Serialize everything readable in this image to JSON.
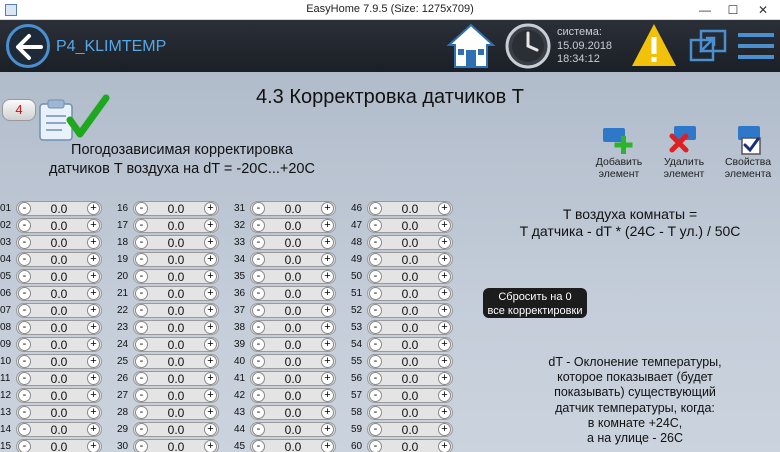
{
  "window": {
    "title": "EasyHome 7.9.5 (Size: 1275x709)",
    "min": "—",
    "max": "☐",
    "close": "✕"
  },
  "header": {
    "page_code": "P4_KLIMTEMP",
    "system_label": "система:",
    "date": "15.09.2018",
    "time": "18:34:12"
  },
  "page": {
    "title": "4.3 Корректровка датчиков T",
    "badge": "4",
    "subtitle_line1": "Погодозависимая корректировка",
    "subtitle_line2": "датчиков T воздуха на dT = -20C...+20C"
  },
  "toolbar": {
    "add_l1": "Добавить",
    "add_l2": "элемент",
    "del_l1": "Удалить",
    "del_l2": "элемент",
    "props_l1": "Свойства",
    "props_l2": "элемента"
  },
  "formula": {
    "line1": "T воздуха комнаты =",
    "line2": "T датчика - dT * (24C - T ул.) / 50C"
  },
  "reset": {
    "line1": "Сбросить на 0",
    "line2": "все корректировки"
  },
  "note": {
    "l1": "dT - Оклонение температуры,",
    "l2": "которое показывает (будет",
    "l3": "показывать) существующий",
    "l4": "датчик температуры, когда:",
    "l5": "в комнате +24С,",
    "l6": "а на улице - 26С"
  },
  "stepper": {
    "minus": "-",
    "plus": "+"
  },
  "sensors": {
    "columns": [
      [
        "01",
        "02",
        "03",
        "04",
        "05",
        "06",
        "07",
        "08",
        "09",
        "10",
        "11",
        "12",
        "13",
        "14",
        "15"
      ],
      [
        "16",
        "17",
        "18",
        "19",
        "20",
        "21",
        "22",
        "23",
        "24",
        "25",
        "26",
        "27",
        "28",
        "29",
        "30"
      ],
      [
        "31",
        "32",
        "33",
        "34",
        "35",
        "36",
        "37",
        "38",
        "39",
        "40",
        "41",
        "42",
        "43",
        "44",
        "45"
      ],
      [
        "46",
        "47",
        "48",
        "49",
        "50",
        "51",
        "52",
        "53",
        "54",
        "55",
        "56",
        "57",
        "58",
        "59",
        "60"
      ]
    ],
    "value": "0.0"
  },
  "colors": {
    "accent": "#4a8fd0",
    "header_bg": "#1f242c",
    "content_bg": "#c3ccd9",
    "warning": "#f2c20a"
  }
}
